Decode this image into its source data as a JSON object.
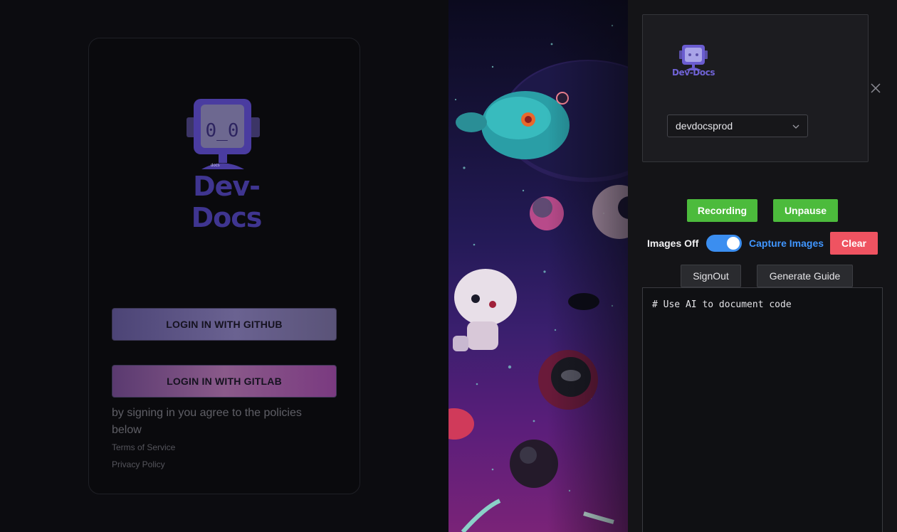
{
  "login": {
    "brand_name": "Dev-Docs",
    "logo_face": "0_0",
    "logo_badge": "docs",
    "github_button": "LOGIN IN WITH GITHUB",
    "gitlab_button": "LOGIN IN WITH GITLAB",
    "agreement_text": "by signing in you agree to the policies below",
    "terms_link": "Terms of Service",
    "privacy_link": "Privacy Policy"
  },
  "panel": {
    "brand_name": "Dev-Docs",
    "org_select_value": "devdocsprod",
    "recording_button": "Recording",
    "unpause_button": "Unpause",
    "images_off_label": "Images Off",
    "images_toggle_on": true,
    "capture_images_label": "Capture Images",
    "clear_button": "Clear",
    "signout_button": "SignOut",
    "generate_guide_button": "Generate Guide",
    "editor_content": "# Use AI to document code"
  },
  "colors": {
    "brand_purple": "#3f3590",
    "panel_brand_purple": "#7063d6",
    "green": "#4cbb3c",
    "red": "#ef5361",
    "blue": "#4096ff"
  },
  "icons": [
    "robot-logo-icon",
    "chevron-down-icon",
    "close-icon"
  ]
}
